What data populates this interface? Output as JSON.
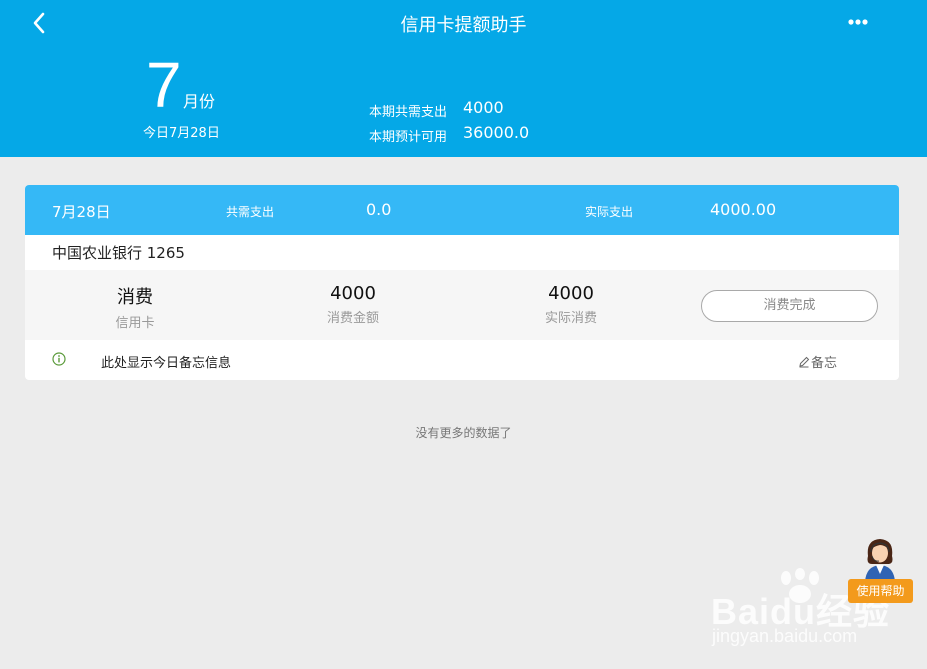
{
  "header": {
    "title": "信用卡提额助手",
    "month_number": "7",
    "month_unit": "月份",
    "today": "今日7月28日",
    "summary": [
      {
        "label": "本期共需支出",
        "value": "4000"
      },
      {
        "label": "本期预计可用",
        "value": "36000.0"
      }
    ],
    "back_icon": "chevron-left-icon",
    "more_icon": "more-dots-icon",
    "background_color": "#05a8e7"
  },
  "card": {
    "date": "7月28日",
    "need_label": "共需支出",
    "need_value": "0.0",
    "actual_label": "实际支出",
    "actual_value": "4000.00",
    "header_color": "#35b8f6",
    "bank": "中国农业银行 1265",
    "detail": {
      "type_value": "消费",
      "type_label": "信用卡",
      "amount_value": "4000",
      "amount_label": "消费金额",
      "actual_value": "4000",
      "actual_label": "实际消费",
      "button": "消费完成"
    },
    "note_text": "此处显示今日备忘信息",
    "memo_button": "备忘",
    "info_icon": "info-circle-icon",
    "memo_icon": "pencil-icon"
  },
  "list_end": "没有更多的数据了",
  "help_button": "使用帮助",
  "watermark": {
    "logo": "Baidu经验",
    "url": "jingyan.baidu.com"
  },
  "accent_color": "#f39a1c"
}
